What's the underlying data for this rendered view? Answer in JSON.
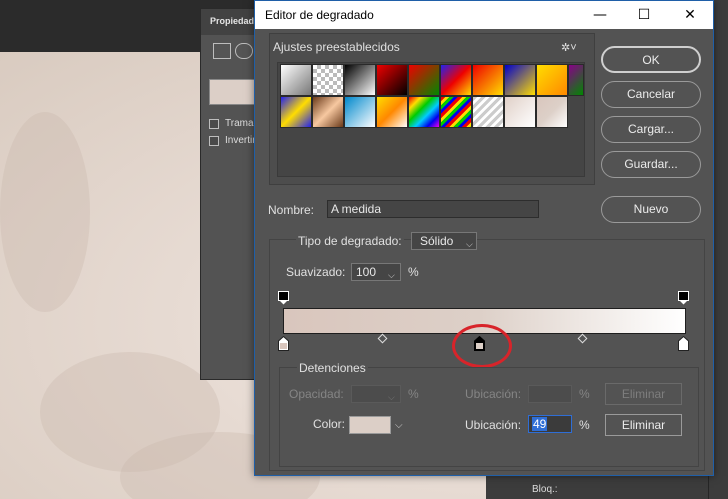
{
  "dialog": {
    "title": "Editor de degradado",
    "minimize": "—",
    "maximize": "☐",
    "close": "✕"
  },
  "background_panel": {
    "title": "Propiedades",
    "checkbox1": "Tramado",
    "checkbox2": "Invertir"
  },
  "presets": {
    "title": "Ajustes preestablecidos",
    "gear": "✲˅"
  },
  "buttons": {
    "ok": "OK",
    "cancel": "Cancelar",
    "load": "Cargar...",
    "save": "Guardar...",
    "new": "Nuevo"
  },
  "name": {
    "label": "Nombre:",
    "value": "A medida"
  },
  "gradient_type": {
    "label": "Tipo de degradado:",
    "value": "Sólido"
  },
  "smoothness": {
    "label": "Suavizado:",
    "value": "100",
    "unit": "%"
  },
  "stops": {
    "title": "Detenciones",
    "opacity_label": "Opacidad:",
    "opacity_unit": "%",
    "location_label_top": "Ubicación:",
    "location_unit_top": "%",
    "delete_top": "Eliminar",
    "color_label": "Color:",
    "location_label": "Ubicación:",
    "location_value": "49",
    "location_unit": "%",
    "delete": "Eliminar",
    "color_value": "#dccfc7"
  },
  "status": {
    "lock_label": "Bloq.:"
  },
  "colors": {
    "accent_selection": "#2f6ed6",
    "annotation_circle": "#d8242a"
  }
}
